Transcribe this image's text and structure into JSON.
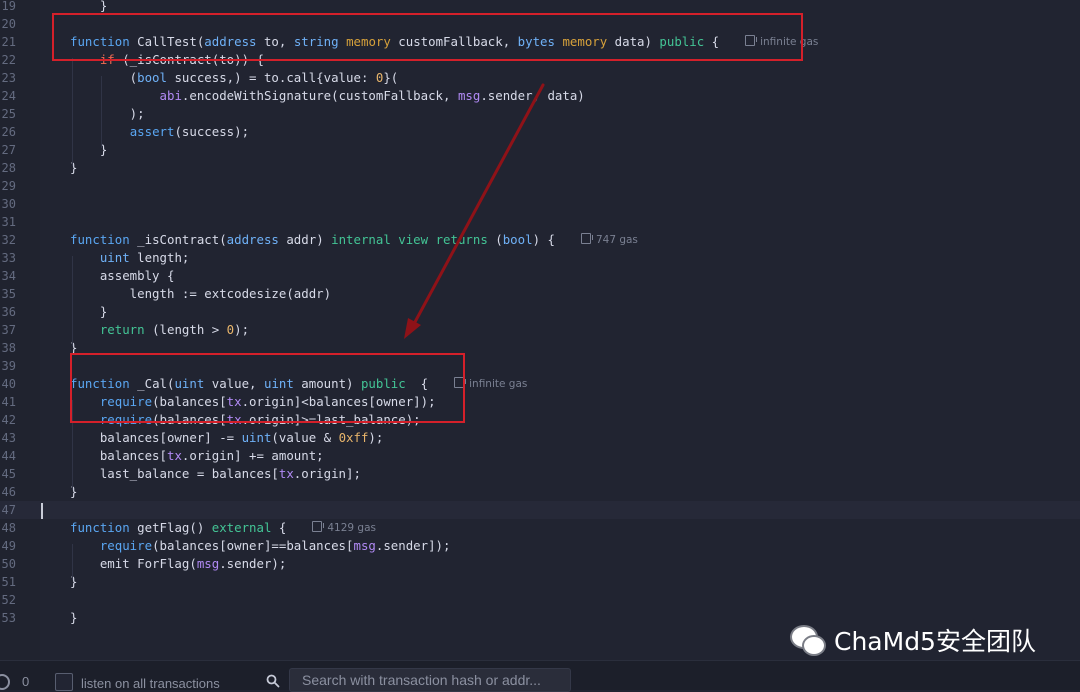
{
  "editor": {
    "lines": [
      {
        "n": "19",
        "segs": [
          {
            "t": "    }",
            "c": ""
          }
        ]
      },
      {
        "n": "20",
        "segs": []
      },
      {
        "n": "21",
        "segs": [
          {
            "t": "function",
            "c": "kw-blue"
          },
          {
            "t": " CallTest(",
            "c": ""
          },
          {
            "t": "address",
            "c": "ty"
          },
          {
            "t": " to, ",
            "c": ""
          },
          {
            "t": "string",
            "c": "ty"
          },
          {
            "t": " ",
            "c": ""
          },
          {
            "t": "memory",
            "c": "kw-orange"
          },
          {
            "t": " customFallback, ",
            "c": ""
          },
          {
            "t": "bytes",
            "c": "ty"
          },
          {
            "t": " ",
            "c": ""
          },
          {
            "t": "memory",
            "c": "kw-orange"
          },
          {
            "t": " data) ",
            "c": ""
          },
          {
            "t": "public",
            "c": "kw-green"
          },
          {
            "t": " {",
            "c": ""
          }
        ],
        "gas": "infinite gas"
      },
      {
        "n": "22",
        "segs": [
          {
            "t": "    ",
            "c": ""
          },
          {
            "t": "if",
            "c": "kw-red"
          },
          {
            "t": " (_isContract(to)) {",
            "c": ""
          }
        ]
      },
      {
        "n": "23",
        "segs": [
          {
            "t": "        (",
            "c": ""
          },
          {
            "t": "bool",
            "c": "ty"
          },
          {
            "t": " success,) = to.call{value: ",
            "c": ""
          },
          {
            "t": "0",
            "c": "num"
          },
          {
            "t": "}(",
            "c": ""
          }
        ]
      },
      {
        "n": "24",
        "segs": [
          {
            "t": "            ",
            "c": ""
          },
          {
            "t": "abi",
            "c": "kw-purple"
          },
          {
            "t": ".encodeWithSignature(customFallback, ",
            "c": ""
          },
          {
            "t": "msg",
            "c": "kw-purple"
          },
          {
            "t": ".sender, data)",
            "c": ""
          }
        ]
      },
      {
        "n": "25",
        "segs": [
          {
            "t": "        );",
            "c": ""
          }
        ]
      },
      {
        "n": "26",
        "segs": [
          {
            "t": "        ",
            "c": ""
          },
          {
            "t": "assert",
            "c": "kw-blue"
          },
          {
            "t": "(success);",
            "c": ""
          }
        ]
      },
      {
        "n": "27",
        "segs": [
          {
            "t": "    }",
            "c": ""
          }
        ]
      },
      {
        "n": "28",
        "segs": [
          {
            "t": "}",
            "c": ""
          }
        ]
      },
      {
        "n": "29",
        "segs": []
      },
      {
        "n": "30",
        "segs": []
      },
      {
        "n": "31",
        "segs": []
      },
      {
        "n": "32",
        "segs": [
          {
            "t": "function",
            "c": "kw-blue"
          },
          {
            "t": " _isContract(",
            "c": ""
          },
          {
            "t": "address",
            "c": "ty"
          },
          {
            "t": " addr) ",
            "c": ""
          },
          {
            "t": "internal",
            "c": "kw-green"
          },
          {
            "t": " ",
            "c": ""
          },
          {
            "t": "view",
            "c": "kw-green"
          },
          {
            "t": " ",
            "c": ""
          },
          {
            "t": "returns",
            "c": "kw-green"
          },
          {
            "t": " (",
            "c": ""
          },
          {
            "t": "bool",
            "c": "ty"
          },
          {
            "t": ") {",
            "c": ""
          }
        ],
        "gas": "747 gas"
      },
      {
        "n": "33",
        "segs": [
          {
            "t": "    ",
            "c": ""
          },
          {
            "t": "uint",
            "c": "ty"
          },
          {
            "t": " length;",
            "c": ""
          }
        ]
      },
      {
        "n": "34",
        "segs": [
          {
            "t": "    assembly {",
            "c": ""
          }
        ]
      },
      {
        "n": "35",
        "segs": [
          {
            "t": "        length := extcodesize(addr)",
            "c": ""
          }
        ]
      },
      {
        "n": "36",
        "segs": [
          {
            "t": "    }",
            "c": ""
          }
        ]
      },
      {
        "n": "37",
        "segs": [
          {
            "t": "    ",
            "c": ""
          },
          {
            "t": "return",
            "c": "kw-green"
          },
          {
            "t": " (length > ",
            "c": ""
          },
          {
            "t": "0",
            "c": "num"
          },
          {
            "t": ");",
            "c": ""
          }
        ]
      },
      {
        "n": "38",
        "segs": [
          {
            "t": "}",
            "c": ""
          }
        ]
      },
      {
        "n": "39",
        "segs": []
      },
      {
        "n": "40",
        "segs": [
          {
            "t": "function",
            "c": "kw-blue"
          },
          {
            "t": " _Cal(",
            "c": ""
          },
          {
            "t": "uint",
            "c": "ty"
          },
          {
            "t": " value, ",
            "c": ""
          },
          {
            "t": "uint",
            "c": "ty"
          },
          {
            "t": " amount) ",
            "c": ""
          },
          {
            "t": "public",
            "c": "kw-green"
          },
          {
            "t": "  {",
            "c": ""
          }
        ],
        "gas": "infinite gas"
      },
      {
        "n": "41",
        "segs": [
          {
            "t": "    ",
            "c": ""
          },
          {
            "t": "require",
            "c": "kw-blue"
          },
          {
            "t": "(balances[",
            "c": ""
          },
          {
            "t": "tx",
            "c": "kw-purple"
          },
          {
            "t": ".origin]<balances[owner]);",
            "c": ""
          }
        ]
      },
      {
        "n": "42",
        "segs": [
          {
            "t": "    ",
            "c": ""
          },
          {
            "t": "require",
            "c": "kw-blue"
          },
          {
            "t": "(balances[",
            "c": ""
          },
          {
            "t": "tx",
            "c": "kw-purple"
          },
          {
            "t": ".origin]>=last_balance);",
            "c": ""
          }
        ]
      },
      {
        "n": "43",
        "segs": [
          {
            "t": "    balances[owner] -= ",
            "c": ""
          },
          {
            "t": "uint",
            "c": "ty"
          },
          {
            "t": "(value & ",
            "c": ""
          },
          {
            "t": "0xff",
            "c": "num"
          },
          {
            "t": ");",
            "c": ""
          }
        ]
      },
      {
        "n": "44",
        "segs": [
          {
            "t": "    balances[",
            "c": ""
          },
          {
            "t": "tx",
            "c": "kw-purple"
          },
          {
            "t": ".origin] += amount;",
            "c": ""
          }
        ]
      },
      {
        "n": "45",
        "segs": [
          {
            "t": "    last_balance = balances[",
            "c": ""
          },
          {
            "t": "tx",
            "c": "kw-purple"
          },
          {
            "t": ".origin];",
            "c": ""
          }
        ]
      },
      {
        "n": "46",
        "segs": [
          {
            "t": "}",
            "c": ""
          }
        ]
      },
      {
        "n": "47",
        "segs": [],
        "active": true
      },
      {
        "n": "48",
        "segs": [
          {
            "t": "function",
            "c": "kw-blue"
          },
          {
            "t": " getFlag() ",
            "c": ""
          },
          {
            "t": "external",
            "c": "kw-green"
          },
          {
            "t": " {",
            "c": ""
          }
        ],
        "gas": "4129 gas"
      },
      {
        "n": "49",
        "segs": [
          {
            "t": "    ",
            "c": ""
          },
          {
            "t": "require",
            "c": "kw-blue"
          },
          {
            "t": "(balances[owner]==balances[",
            "c": ""
          },
          {
            "t": "msg",
            "c": "kw-purple"
          },
          {
            "t": ".sender]);",
            "c": ""
          }
        ]
      },
      {
        "n": "50",
        "segs": [
          {
            "t": "    emit ForFlag(",
            "c": ""
          },
          {
            "t": "msg",
            "c": "kw-purple"
          },
          {
            "t": ".sender);",
            "c": ""
          }
        ]
      },
      {
        "n": "51",
        "segs": [
          {
            "t": "}",
            "c": ""
          }
        ]
      },
      {
        "n": "52",
        "segs": []
      },
      {
        "n": "53",
        "segs": [
          {
            "t": "}",
            "c": ""
          }
        ]
      }
    ]
  },
  "colors": {
    "annotation": "#d4202a",
    "arrow": "#8e1218",
    "background": "#212431"
  },
  "watermark": {
    "text": "ChaMd5安全团队",
    "icon": "wechat-icon"
  },
  "bottombar": {
    "count": "0",
    "listen_label": "listen on all transactions",
    "search_placeholder": "Search with transaction hash or addr..."
  }
}
